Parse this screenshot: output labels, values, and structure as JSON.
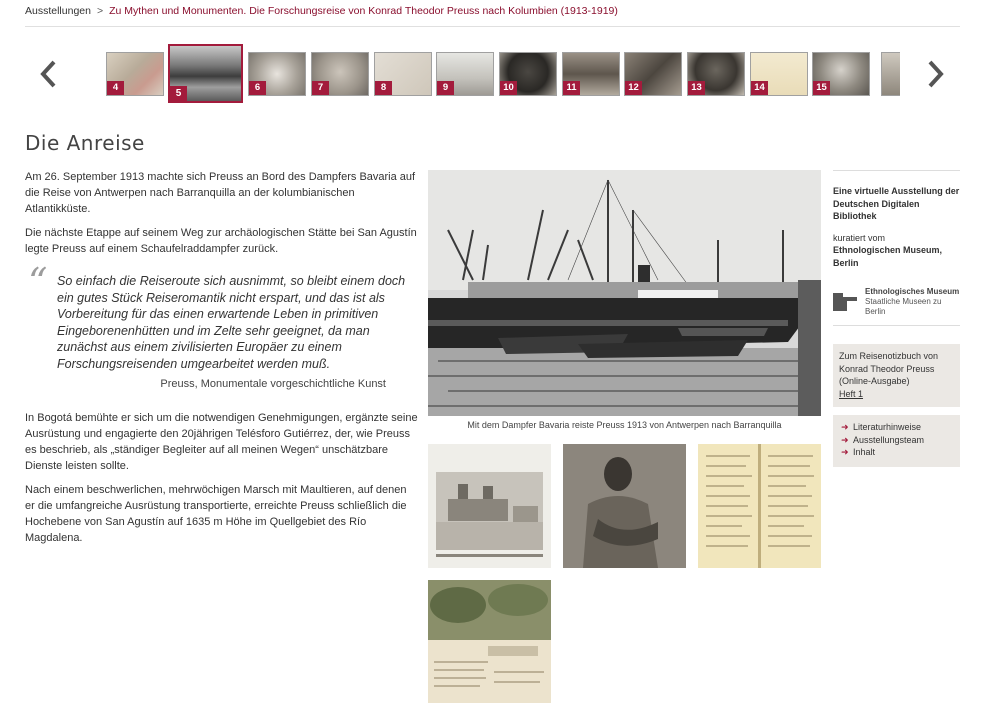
{
  "breadcrumb": {
    "root": "Ausstellungen",
    "separator": ">",
    "current": "Zu Mythen und Monumenten. Die Forschungsreise von Konrad Theodor Preuss nach Kolumbien (1913-1919)"
  },
  "carousel": {
    "prev_icon": "chevron-left-icon",
    "next_icon": "chevron-right-icon",
    "thumbnails": [
      {
        "number": "4"
      },
      {
        "number": "5",
        "active": true
      },
      {
        "number": "6"
      },
      {
        "number": "7"
      },
      {
        "number": "8"
      },
      {
        "number": "9"
      },
      {
        "number": "10"
      },
      {
        "number": "11"
      },
      {
        "number": "12"
      },
      {
        "number": "13"
      },
      {
        "number": "14"
      },
      {
        "number": "15"
      }
    ]
  },
  "page": {
    "title": "Die Anreise",
    "paragraphs": [
      "Am 26. September 1913 machte sich Preuss an Bord des Dampfers Bavaria auf die Reise von Antwerpen nach Barranquilla an der kolumbianischen Atlantikküste.",
      "Die nächste Etappe auf seinem Weg zur archäologischen Stätte bei San Agustín legte Preuss auf einem Schaufelraddampfer zurück."
    ],
    "quote": {
      "mark": "“",
      "text": "So einfach die Reiseroute sich ausnimmt, so bleibt einem doch ein gutes Stück Reiseromantik nicht erspart, und das ist als Vorbereitung für das einen erwartende Leben in primitiven Eingeborenenhütten und im Zelte sehr geeignet, da man zunächst aus einem zivilisierten Europäer zu einem Forschungsreisenden umgearbeitet werden muß.",
      "source": "Preuss, Monumentale vorgeschichtliche Kunst"
    },
    "paragraphs_after": [
      "In Bogotá bemühte er sich um die notwendigen Genehmigungen, ergänzte seine Ausrüstung und engagierte den 20jährigen Telésforo Gutiérrez, der, wie Preuss es beschrieb, als „ständiger Begleiter auf all meinen Wegen“ unschätzbare Dienste leisten sollte.",
      "Nach einem beschwerlichen, mehrwöchigen Marsch mit Maultieren, auf denen er die umfangreiche Ausrüstung transportierte, erreichte Preuss schließlich die Hochebene von San Agustín auf 1635 m Höhe im Quellgebiet des Río Magdalena."
    ],
    "main_image_caption": "Mit dem Dampfer Bavaria reiste Preuss 1913 von Antwerpen nach Barranquilla"
  },
  "sidebar": {
    "intro_bold": "Eine virtuelle Ausstellung der Deutschen Digitalen Bibliothek",
    "curated_by": "kuratiert vom",
    "curator_bold": "Ethnologischen Museum, Berlin",
    "museum_name": "Ethnologisches Museum",
    "museum_sub": "Staatliche Museen zu Berlin",
    "notebook_text": "Zum Reisenotizbuch von Konrad Theodor Preuss (Online-Ausgabe)",
    "notebook_link": "Heft 1",
    "links": [
      "Literaturhinweise",
      "Ausstellungsteam",
      "Inhalt"
    ]
  }
}
